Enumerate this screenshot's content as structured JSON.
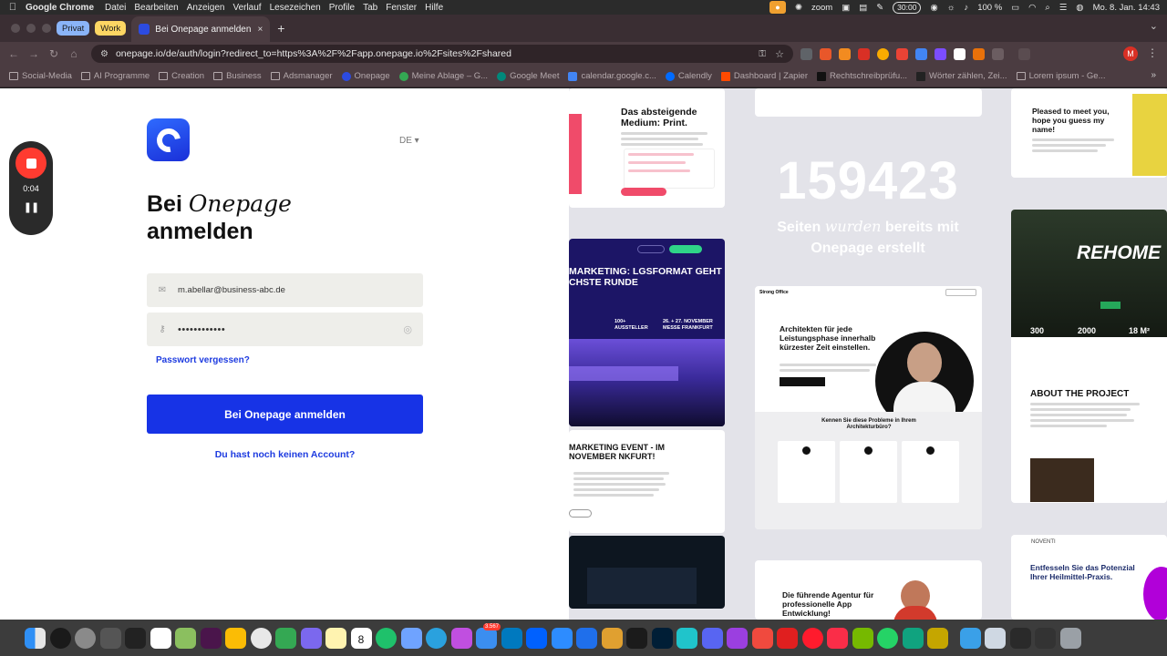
{
  "menubar": {
    "apple": "",
    "app_name": "Google Chrome",
    "menus": [
      "Datei",
      "Bearbeiten",
      "Anzeigen",
      "Verlauf",
      "Lesezeichen",
      "Profile",
      "Tab",
      "Fenster",
      "Hilfe"
    ],
    "zoom_label": "zoom",
    "timer": "30:00",
    "battery": "100 %",
    "datetime": "Mo. 8. Jan. 14:43"
  },
  "tabs": {
    "groups": [
      {
        "label": "Privat",
        "color": "#8ab4f8"
      },
      {
        "label": "Work",
        "color": "#fdd663"
      }
    ],
    "active_title": "Bei Onepage anmelden",
    "close": "×",
    "new_tab": "+",
    "chevron": "⌄"
  },
  "toolbar": {
    "back": "←",
    "forward": "→",
    "reload": "↻",
    "home": "⌂",
    "url": "onepage.io/de/auth/login?redirect_to=https%3A%2F%2Fapp.onepage.io%2Fsites%2Fshared",
    "profile_initial": "M",
    "menu": "⋮"
  },
  "bookmarks": {
    "items": [
      {
        "label": "Social-Media",
        "type": "folder"
      },
      {
        "label": "AI Programme",
        "type": "folder"
      },
      {
        "label": "Creation",
        "type": "folder"
      },
      {
        "label": "Business",
        "type": "folder"
      },
      {
        "label": "Adsmanager",
        "type": "folder"
      },
      {
        "label": "Onepage",
        "type": "site",
        "color": "#2c4be0"
      },
      {
        "label": "Meine Ablage – G...",
        "type": "site",
        "color": "#34a853"
      },
      {
        "label": "Google Meet",
        "type": "site",
        "color": "#00897b"
      },
      {
        "label": "calendar.google.c...",
        "type": "site",
        "color": "#4285f4"
      },
      {
        "label": "Calendly",
        "type": "site",
        "color": "#006bff"
      },
      {
        "label": "Dashboard | Zapier",
        "type": "site",
        "color": "#ff4a00"
      },
      {
        "label": "Rechtschreibprüfu...",
        "type": "site",
        "color": "#111111"
      },
      {
        "label": "Wörter zählen, Zei...",
        "type": "site",
        "color": "#222222"
      },
      {
        "label": "Lorem ipsum - Ge...",
        "type": "site",
        "color": "#8a7d80"
      }
    ],
    "more": "»"
  },
  "login": {
    "language": "DE ▾",
    "title_prefix": "Bei ",
    "title_brand": "Onepage",
    "title_suffix": "anmelden",
    "email_value": "m.abellar@business-abc.de",
    "password_value": "••••••••••••",
    "forgot_password": "Passwort vergessen?",
    "submit_label": "Bei Onepage anmelden",
    "no_account": "Du hast noch keinen Account?"
  },
  "showcase": {
    "counter": "159423",
    "subtitle_part1": "Seiten ",
    "subtitle_italic": "wurden",
    "subtitle_part2": " bereits mit",
    "subtitle_line2": "Onepage erstellt",
    "card_print_title": "Das absteigende Medium: Print.",
    "card_marketing_title1": "MARKETING: LGSFORMAT GEHT CHSTE RUNDE",
    "card_marketing_stats": [
      "100+ AUSSTELLER",
      "26. + 27. NOVEMBER MESSE FRANKFURT"
    ],
    "card_marketing_event": "MARKETING EVENT - IM NOVEMBER NKFURT!",
    "card_architect_brand": "Strong Office",
    "card_architect_title": "Architekten für jede Leistungsphase innerhalb kürzester Zeit einstellen.",
    "card_architect_q": "Kennen Sie diese Probleme in Ihrem Architekturbüro?",
    "card_meet_title": "Pleased to meet you, hope you guess my name!",
    "card_rehome_logo": "REHOME",
    "card_rehome_stats": [
      "300",
      "2000",
      "18 M²"
    ],
    "card_about_title": "ABOUT THE PROJECT",
    "card_app_title": "Die führende Agentur für professionelle App Entwicklung!",
    "card_noventi_title": "Entfesseln Sie das Potenzial Ihrer Heilmittel-Praxis."
  },
  "recorder": {
    "time": "0:04",
    "pause": "❚❚"
  },
  "dock": {
    "calendar_day": "8",
    "mail_badge": "3.567",
    "icons": [
      "finder-icon",
      "safari-icon",
      "settings-icon",
      "calculator-icon",
      "app-icon",
      "notion-icon",
      "grid-icon",
      "slack-icon",
      "photos-icon",
      "chrome-icon",
      "drive-icon",
      "clickup-icon",
      "notes-icon",
      "calendar-icon",
      "messenger-icon",
      "craft-icon",
      "telegram-icon",
      "mail-icon",
      "trello-icon",
      "dropbox-icon",
      "zoom-icon",
      "apps-icon",
      "vpn-icon",
      "capture-icon",
      "lightroom-icon",
      "canva-icon",
      "discord-icon",
      "podcasts-icon",
      "fantastical-icon",
      "acrobat-icon",
      "opera-icon",
      "music-icon",
      "nvidia-icon",
      "whatsapp-icon",
      "chatgpt-icon",
      "bitcoin-icon",
      "folder-icon",
      "preview-icon",
      "window-icon",
      "window-icon-2",
      "trash-icon"
    ]
  }
}
